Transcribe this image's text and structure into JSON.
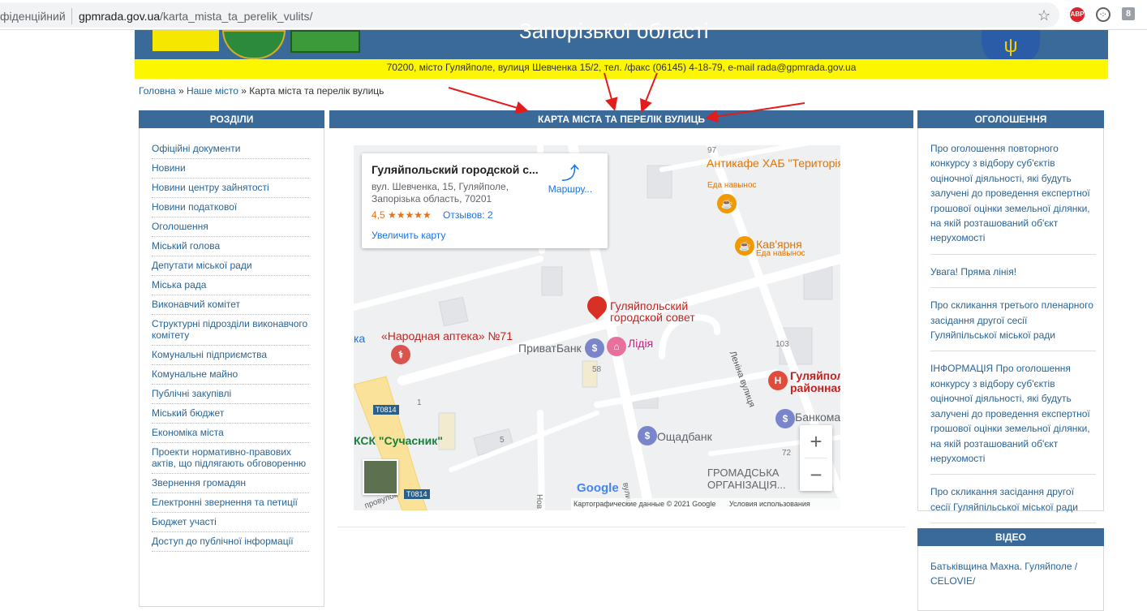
{
  "browser": {
    "security_label": "фіденційний",
    "url_domain": "gpmrada.gov.ua",
    "url_path": "/karta_mista_ta_perelik_vulits/",
    "ext_abp": "ABP",
    "ext3": "8"
  },
  "header": {
    "title": "Запорізької області",
    "contact": "70200, місто Гуляйполе, вулиця Шевченка 15/2, тел. /факс (06145) 4-18-79, e-mail rada@gpmrada.gov.ua"
  },
  "breadcrumb": {
    "home": "Головна",
    "sep1": "»",
    "section": "Наше місто",
    "sep2": "»",
    "current": "Карта міста та перелік вулиць"
  },
  "left_panel": {
    "title": "РОЗДІЛИ",
    "items": [
      "Офіційні документи",
      "Новини",
      "Новини центру зайнятості",
      "Новини податкової",
      "Оголошення",
      "Міський голова",
      "Депутати міської ради",
      "Міська рада",
      "Виконавчий комітет",
      "Структурні підрозділи виконавчого комітету",
      "Комунальні підприємства",
      "Комунальне майно",
      "Публічні закупівлі",
      "Міський бюджет",
      "Економіка міста",
      "Проекти нормативно-правових актів, що підлягають обговоренню",
      "Звернення громадян",
      "Електронні звернення та петиції",
      "Бюджет участі",
      "Доступ до публічної інформації"
    ]
  },
  "main": {
    "title": "КАРТА МІСТА ТА ПЕРЕЛІК ВУЛИЦЬ"
  },
  "map": {
    "card": {
      "title": "Гуляйпольский городской с...",
      "address": "вул. Шевченка, 15, Гуляйполе, Запорізька область, 70201",
      "rating": "4,5 ★★★★★",
      "reviews": "Отзывов: 2",
      "enlarge": "Увеличить карту",
      "route": "Маршру..."
    },
    "labels": {
      "place_main": "Гуляйпольский городской совет",
      "anticafe": "Антикафе ХАБ \"Територія свободи\"",
      "anticafe_sub": "Еда навынос",
      "cafe": "Кав'ярня",
      "cafe_sub": "Еда навынос",
      "pharmacy": "«Народная аптека» №71",
      "privat": "ПриватБанк",
      "lidia": "Лідія",
      "oschad": "Ощадбанк",
      "hospital": "Гуляйпол районная",
      "bankomat": "Банкома",
      "gromada": "ГРОМАДСЬКА ОРГАНІЗАЦІЯ...",
      "sk": "КСК \"Сучасник\"",
      "lenina": "Леніна вулиця",
      "vulits": "вулиц",
      "provulok": "провулок",
      "nov": "Нов",
      "ka": "ка",
      "road1": "T0814",
      "road2": "T0814",
      "n97": "97",
      "n103": "103",
      "n58": "58",
      "n5": "5",
      "n72": "72",
      "n1": "1"
    },
    "zoom_in": "+",
    "zoom_out": "−",
    "logo": "Google",
    "attribution": "Картографические данные © 2021 Google",
    "terms": "Условия использования"
  },
  "right_panel": {
    "title": "ОГОЛОШЕННЯ",
    "items": [
      "Про оголошення повторного конкурсу з відбору суб'єктів оціночної діяльності, які будуть залучені до проведення експертної грошової оцінки земельної ділянки, на якій розташований об'єкт нерухомості",
      "Увага! Пряма лінія!",
      "Про скликання третього пленарного засідання другої сесії Гуляйпільської міської ради",
      "ІНФОРМАЦІЯ Про оголошення конкурсу з відбору суб'єктів оціночної діяльності, які будуть залучені до проведення експертної грошової оцінки земельної ділянки, на якій розташований об'єкт нерухомості",
      "Про скликання засідання другої сесії Гуляйпільської міської ради"
    ]
  },
  "video_panel": {
    "title": "ВІДЕО",
    "item": "Батьківщина Махна. Гуляйполе / CELOVIE/"
  },
  "colors": {
    "header_blue": "#3a6a99",
    "link": "#2a6496",
    "yellow": "#fcf600",
    "annotation_red": "#e31b1b"
  }
}
